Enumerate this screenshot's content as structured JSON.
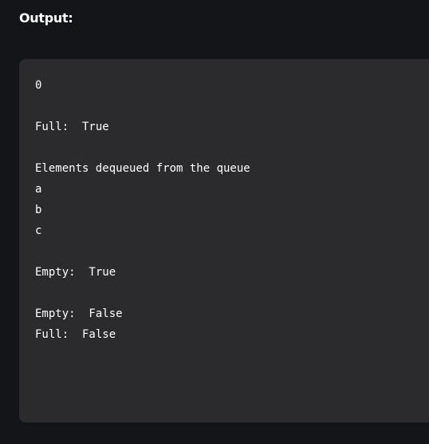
{
  "heading": "Output:",
  "output_lines": [
    "0",
    "",
    "Full:  True",
    "",
    "Elements dequeued from the queue",
    "a",
    "b",
    "c",
    "",
    "Empty:  True",
    "",
    "Empty:  False",
    "Full:  False"
  ]
}
